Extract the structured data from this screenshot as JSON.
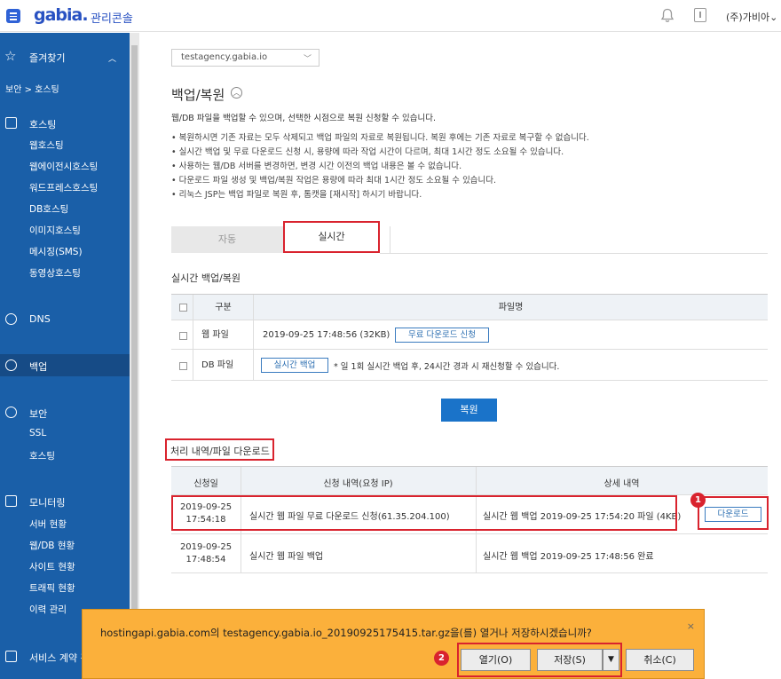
{
  "header": {
    "logo": "gabia.",
    "console_label": "관리콘솔",
    "user": "(주)가비아"
  },
  "sidebar": {
    "favorites": "즐겨찾기",
    "breadcrumb": "보안 > 호스팅",
    "hosting_group": "호스팅",
    "hosting_items": [
      "웹호스팅",
      "웹에이전시호스팅",
      "워드프레스호스팅",
      "DB호스팅",
      "이미지호스팅",
      "메시징(SMS)",
      "동영상호스팅"
    ],
    "dns": "DNS",
    "backup": "백업",
    "security_group": "보안",
    "security_items": [
      "SSL",
      "호스팅"
    ],
    "monitoring_group": "모니터링",
    "monitoring_items": [
      "서버 현황",
      "웹/DB 현황",
      "사이트 현황",
      "트래픽 현황",
      "이력 관리"
    ],
    "service_contract": "서비스 계약 관"
  },
  "main": {
    "domain_select": "testagency.gabia.io",
    "title": "백업/복원",
    "description": "웹/DB 파일을 백업할 수 있으며, 선택한 시점으로 복원 신청할 수 있습니다.",
    "bullets": [
      "복원하시면 기존 자료는 모두 삭제되고 백업 파일의 자료로 복원됩니다. 복원 후에는 기존 자료로 복구할 수 없습니다.",
      "실시간 백업 및 무료 다운로드 신청 시, 용량에 따라 작업 시간이 다르며, 최대 1시간 정도 소요될 수 있습니다.",
      "사용하는 웹/DB 서버를 변경하면, 변경 시간 이전의 백업 내용은 볼 수 없습니다.",
      "다운로드 파일 생성 및 백업/복원 작업은 용량에 따라 최대 1시간 정도 소요될 수 있습니다.",
      "리눅스 JSP는 백업 파일로 복원 후, 톰캣을 [재시작] 하시기 바랍니다."
    ],
    "tabs": {
      "auto": "자동",
      "realtime": "실시간"
    },
    "realtime_section_title": "실시간 백업/복원",
    "backup_table": {
      "headers": [
        "구분",
        "파일명"
      ],
      "rows": [
        {
          "type": "웹 파일",
          "file": "2019-09-25 17:48:56 (32KB)",
          "button": "무료 다운로드 신청"
        },
        {
          "type": "DB 파일",
          "button": "실시간 백업",
          "note": "* 일 1회 실시간 백업 후, 24시간 경과 시 재신청할 수 있습니다."
        }
      ]
    },
    "restore_button": "복원",
    "history_section_title": "처리 내역/파일 다운로드",
    "history_table": {
      "headers": [
        "신청일",
        "신청 내역(요청 IP)",
        "상세 내역"
      ],
      "rows": [
        {
          "date": "2019-09-25",
          "time": "17:54:18",
          "request": "실시간 웹 파일 무료 다운로드 신청(61.35.204.100)",
          "detail": "실시간 웹 백업 2019-09-25 17:54:20 파일 (4KB)",
          "button": "다운로드"
        },
        {
          "date": "2019-09-25",
          "time": "17:48:54",
          "request": "실시간 웹 파일 백업",
          "detail": "실시간 웹 백업 2019-09-25 17:48:56 완료"
        }
      ]
    },
    "badges": [
      "1",
      "2"
    ]
  },
  "download_bar": {
    "host": "hostingapi.gabia.com",
    "connector1": "의 ",
    "filename": "testagency.gabia.io_20190925175415.tar.gz",
    "suffix": "을(를) 열거나 저장하시겠습니까?",
    "open": "열기(O)",
    "save": "저장(S)",
    "cancel": "취소(C)",
    "close": "×"
  },
  "colors": {
    "brand": "#2851c2",
    "sidebar": "#1a5fa8",
    "highlight": "#d9232e",
    "primary_button": "#1a73c9",
    "download_bar": "#fbb03b"
  }
}
